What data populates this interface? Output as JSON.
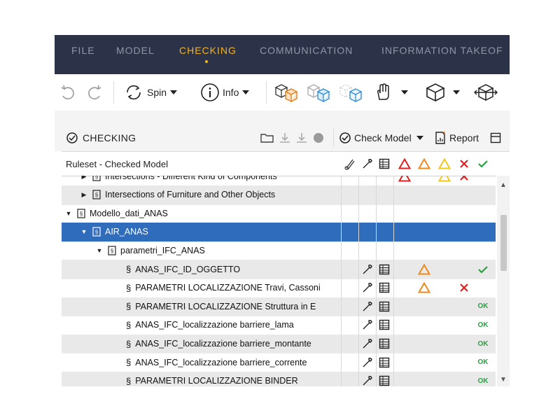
{
  "menu": {
    "items": [
      {
        "label": "FILE"
      },
      {
        "label": "MODEL"
      },
      {
        "label": "CHECKING"
      },
      {
        "label": "COMMUNICATION"
      },
      {
        "label": "INFORMATION TAKEOF"
      }
    ],
    "active_index": 2
  },
  "toolbar": {
    "spin_label": "Spin",
    "info_label": "Info"
  },
  "panel": {
    "title": "CHECKING",
    "check_model_label": "Check Model",
    "report_label": "Report"
  },
  "grid": {
    "column_title": "Ruleset - Checked Model",
    "rows": [
      {
        "label": "Intersections - Different Kind of Components",
        "ok": ""
      },
      {
        "label": "Intersections of Furniture and Other Objects",
        "ok": ""
      },
      {
        "label": "Modello_dati_ANAS",
        "ok": ""
      },
      {
        "label": "AIR_ANAS",
        "ok": ""
      },
      {
        "label": "parametri_IFC_ANAS",
        "ok": ""
      },
      {
        "label": "ANAS_IFC_ID_OGGETTO",
        "ok": ""
      },
      {
        "label": "PARAMETRI LOCALIZZAZIONE Travi, Cassoni",
        "ok": ""
      },
      {
        "label": "PARAMETRI LOCALIZZAZIONE   Struttura in E",
        "ok": "OK"
      },
      {
        "label": "ANAS_IFC_localizzazione barriere_lama",
        "ok": "OK"
      },
      {
        "label": "ANAS_IFC_localizzazione barriere_montante",
        "ok": "OK"
      },
      {
        "label": "ANAS_IFC_localizzazione barriere_corrente",
        "ok": "OK"
      },
      {
        "label": "PARAMETRI LOCALIZZAZIONE BINDER",
        "ok": "OK"
      }
    ]
  },
  "colors": {
    "menu_bg": "#2c3348",
    "menu_text": "#8e96a8",
    "accent": "#f5b21a",
    "selection": "#2f6cbc",
    "critical": "#e02020",
    "moderate": "#f08a1c",
    "minor": "#f2c81c",
    "passed": "#27a142"
  },
  "icons": [
    "undo-icon",
    "redo-icon",
    "spin-icon",
    "info-icon",
    "caret-down-icon",
    "hide-selected-icon",
    "transparent-icon",
    "ghost-icon",
    "hand-icon",
    "box-view-icon",
    "section-box-icon",
    "checking-icon",
    "folder-icon",
    "download-icon",
    "record-icon",
    "check-model-icon",
    "report-icon",
    "window-icon",
    "component-icon",
    "wrench-icon",
    "table-icon",
    "severity-critical-icon",
    "severity-moderate-icon",
    "severity-minor-icon",
    "rejected-icon",
    "accepted-icon",
    "rule-icon",
    "ruleset-icon"
  ]
}
